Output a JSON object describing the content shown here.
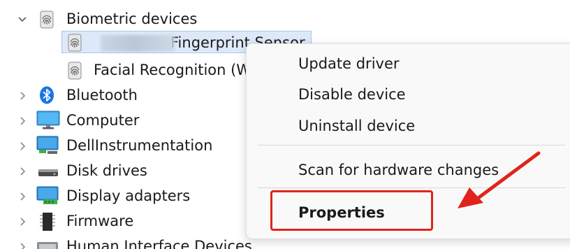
{
  "device_tree": {
    "items": [
      {
        "label": "Biometric devices",
        "icon": "fingerprint-icon",
        "expanded": true
      },
      {
        "label": "Fingerprint Sensor",
        "icon": "fingerprint-icon",
        "child": true,
        "selected": true,
        "redacted_prefix": true
      },
      {
        "label": "Facial Recognition (W",
        "icon": "fingerprint-icon",
        "child": true
      },
      {
        "label": "Bluetooth",
        "icon": "bluetooth-icon"
      },
      {
        "label": "Computer",
        "icon": "monitor-icon"
      },
      {
        "label": "DellInstrumentation",
        "icon": "network-monitor-icon"
      },
      {
        "label": "Disk drives",
        "icon": "disk-drive-icon"
      },
      {
        "label": "Display adapters",
        "icon": "display-adapter-icon"
      },
      {
        "label": "Firmware",
        "icon": "firmware-chip-icon"
      },
      {
        "label": "Human Interface Devices",
        "icon": "hid-icon"
      }
    ]
  },
  "context_menu": {
    "update_driver": "Update driver",
    "disable_device": "Disable device",
    "uninstall_device": "Uninstall device",
    "scan_hardware": "Scan for hardware changes",
    "properties": "Properties"
  },
  "colors": {
    "annotation_red": "#e0241b",
    "selection_bg": "#dde9f8",
    "bluetooth_blue": "#1a74e8"
  }
}
